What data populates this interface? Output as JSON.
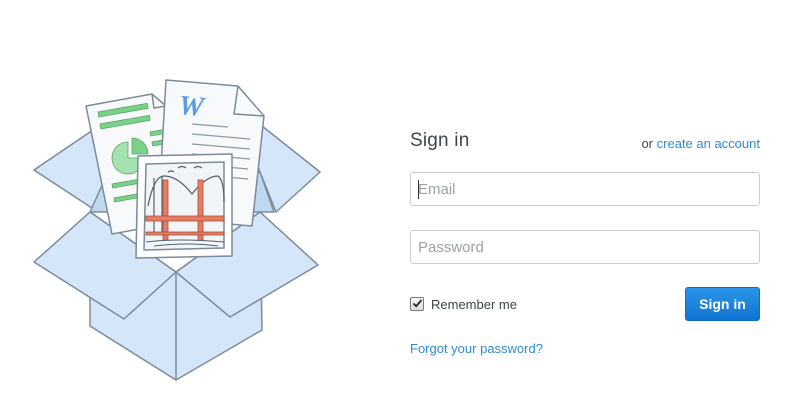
{
  "signin": {
    "title": "Sign in",
    "or_text": "or",
    "create_account_link": "create an account",
    "email": {
      "placeholder": "Email",
      "value": ""
    },
    "password": {
      "placeholder": "Password",
      "value": ""
    },
    "remember_me": {
      "label": "Remember me",
      "checked": true
    },
    "submit_label": "Sign in",
    "forgot_link": "Forgot your password?"
  },
  "illustration": {
    "icon": "open-box-with-documents-icon",
    "document_letter": "W"
  },
  "colors": {
    "accent": "#2e8ad8",
    "button": "#1581dc",
    "box_fill": "#d4e6f8",
    "box_stroke": "#7b8b9a",
    "text": "#3d464d"
  }
}
